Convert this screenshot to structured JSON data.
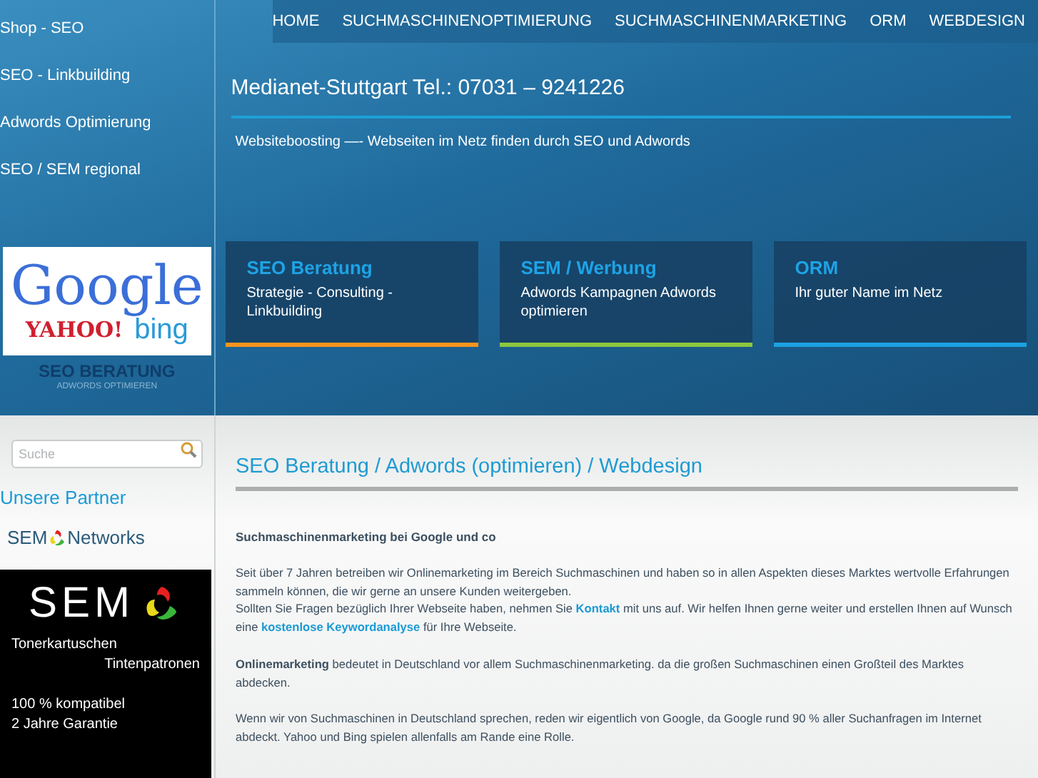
{
  "sidebar": {
    "links": [
      "Shop - SEO",
      "SEO - Linkbuilding",
      "Adwords Optimierung",
      "SEO / SEM regional"
    ],
    "banner": {
      "logos": [
        "Google",
        "YAHOO!",
        "bing"
      ],
      "title": "SEO BERATUNG",
      "subtitle": "ADWORDS OPTIMIEREN"
    },
    "search": {
      "placeholder": "Suche"
    },
    "partners_heading": "Unsere Partner",
    "partner_logo": {
      "left": "SEM",
      "right": "Networks"
    },
    "ad": {
      "logo": "SEM",
      "lines": [
        "Tonerkartuschen",
        "Tintenpatronen",
        "100 % kompatibel",
        "2 Jahre Garantie"
      ]
    }
  },
  "nav": [
    "HOME",
    "SUCHMASCHINENOPTIMIERUNG",
    "SUCHMASCHINENMARKETING",
    "ORM",
    "WEBDESIGN"
  ],
  "header": {
    "title": "Medianet-Stuttgart Tel.: 07031 – 9241226",
    "tagline": "Websiteboosting —- Webseiten im Netz finden durch SEO und Adwords"
  },
  "cards": [
    {
      "title": "SEO Beratung",
      "text": "Strategie - Consulting - Linkbuilding",
      "color": "#f7941d"
    },
    {
      "title": "SEM / Werbung",
      "text": "Adwords Kampagnen Adwords optimieren",
      "color": "#8dc63f"
    },
    {
      "title": "ORM",
      "text": "Ihr guter Name im Netz",
      "color": "#1ba1e2"
    }
  ],
  "content": {
    "heading": "SEO Beratung / Adwords (optimieren) / Webdesign",
    "subheading": "Suchmaschinenmarketing bei Google und co",
    "blocks": [
      [
        [
          {
            "kind": "text",
            "text": "Seit über 7 Jahren betreiben wir Onlinemarketing im Bereich Suchmaschinen und haben so in allen Aspekten dieses Marktes wertvolle Erfahrungen sammeln können, die wir gerne an unsere Kunden weitergeben."
          }
        ],
        [
          {
            "kind": "text",
            "text": "Sollten Sie Fragen bezüglich Ihrer Webseite haben, nehmen Sie "
          },
          {
            "kind": "link",
            "text": "Kontakt"
          },
          {
            "kind": "text",
            "text": " mit uns auf. Wir helfen Ihnen gerne weiter und erstellen Ihnen auf Wunsch eine "
          },
          {
            "kind": "link",
            "text": "kostenlose Keywordanalyse"
          },
          {
            "kind": "text",
            "text": " für Ihre Webseite."
          }
        ]
      ],
      [
        [
          {
            "kind": "text",
            "text": "**Onlinemarketing** bedeutet in Deutschland vor allem Suchmaschinenmarketing. da die großen Suchmaschinen einen Großteil des Marktes abdecken."
          }
        ]
      ],
      [
        [
          {
            "kind": "text",
            "text": "Wenn wir von Suchmaschinen in Deutschland sprechen, reden wir eigentlich von Google, da Google rund 90 % aller Suchanfragen im Internet abdeckt. Yahoo und Bing spielen allenfalls am Rande eine Rolle."
          }
        ]
      ]
    ]
  }
}
